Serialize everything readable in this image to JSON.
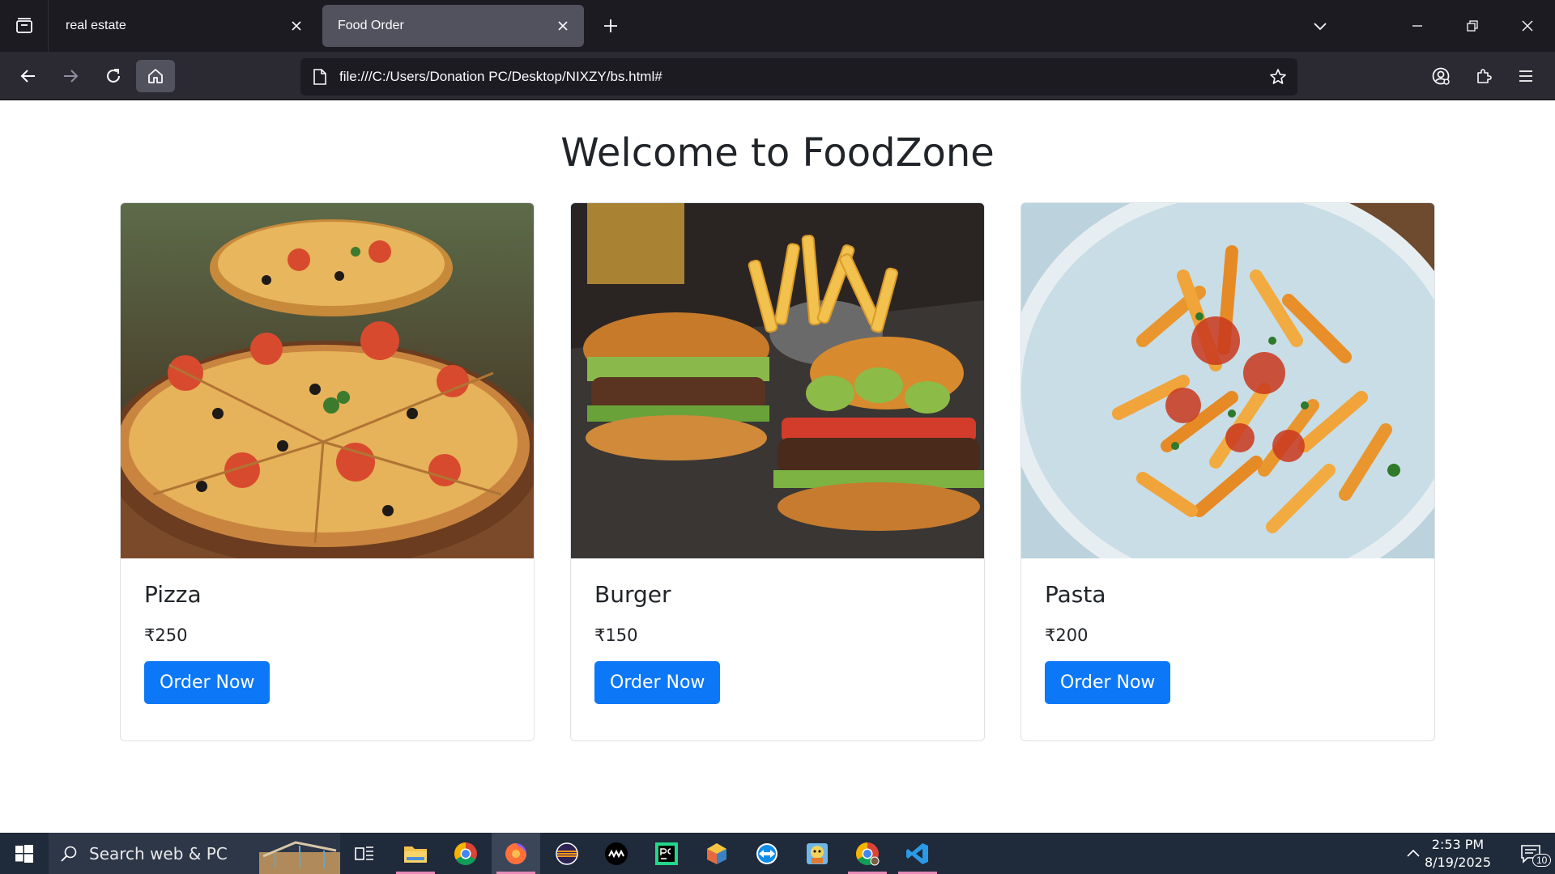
{
  "browser": {
    "tabs": [
      {
        "label": "real estate",
        "active": false
      },
      {
        "label": "Food Order",
        "active": true
      }
    ],
    "url": "file:///C:/Users/Donation PC/Desktop/NIXZY/bs.html#"
  },
  "page": {
    "title": "Welcome to FoodZone",
    "cards": [
      {
        "name": "Pizza",
        "price": "₹250",
        "button": "Order Now",
        "image": "pizza-photo"
      },
      {
        "name": "Burger",
        "price": "₹150",
        "button": "Order Now",
        "image": "burger-photo"
      },
      {
        "name": "Pasta",
        "price": "₹200",
        "button": "Order Now",
        "image": "pasta-photo"
      }
    ]
  },
  "taskbar": {
    "search_placeholder": "Search web & PC",
    "apps": [
      "task-view-icon",
      "file-explorer-icon",
      "chrome-icon",
      "firefox-icon",
      "eclipse-icon",
      "nvidia-icon",
      "pycharm-icon",
      "app-cube-icon",
      "teamviewer-icon",
      "app-mascot-icon",
      "chrome-profile-icon",
      "vscode-icon"
    ],
    "time": "2:53 PM",
    "date": "8/19/2025",
    "notification_count": "10"
  },
  "colors": {
    "tab_strip": "#1c1b22",
    "toolbar": "#2b2a33",
    "button_primary": "#0d78f7",
    "taskbar": "#1f2a3a"
  }
}
